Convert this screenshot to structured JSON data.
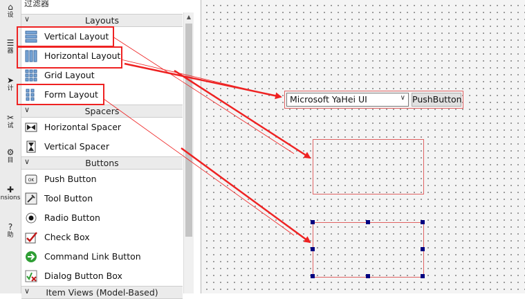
{
  "filter_label": "过滤器",
  "left_strip": [
    {
      "glyph": "⌂",
      "label": "设"
    },
    {
      "glyph": "☰",
      "label": "器"
    },
    {
      "glyph": "➤",
      "label": "计"
    },
    {
      "glyph": "✂",
      "label": "试"
    },
    {
      "glyph": "⚙",
      "label": "目"
    },
    {
      "glyph": "✚",
      "label": "nsions"
    },
    {
      "glyph": "?",
      "label": "助"
    }
  ],
  "widget_box": {
    "categories": {
      "layouts": "Layouts",
      "spacers": "Spacers",
      "buttons": "Buttons",
      "item_views": "Item Views (Model-Based)"
    },
    "items": {
      "vertical_layout": "Vertical Layout",
      "horizontal_layout": "Horizontal Layout",
      "grid_layout": "Grid Layout",
      "form_layout": "Form Layout",
      "horizontal_spacer": "Horizontal Spacer",
      "vertical_spacer": "Vertical Spacer",
      "push_button": "Push Button",
      "tool_button": "Tool Button",
      "radio_button": "Radio Button",
      "check_box": "Check Box",
      "command_link_button": "Command Link Button",
      "dialog_button_box": "Dialog Button Box"
    }
  },
  "form": {
    "combo_value": "Microsoft YaHei UI",
    "push_button_label": "PushButton"
  },
  "colors": {
    "annotation": "#ee2222",
    "layout_border": "#e06262",
    "selection_handle": "#000080"
  }
}
